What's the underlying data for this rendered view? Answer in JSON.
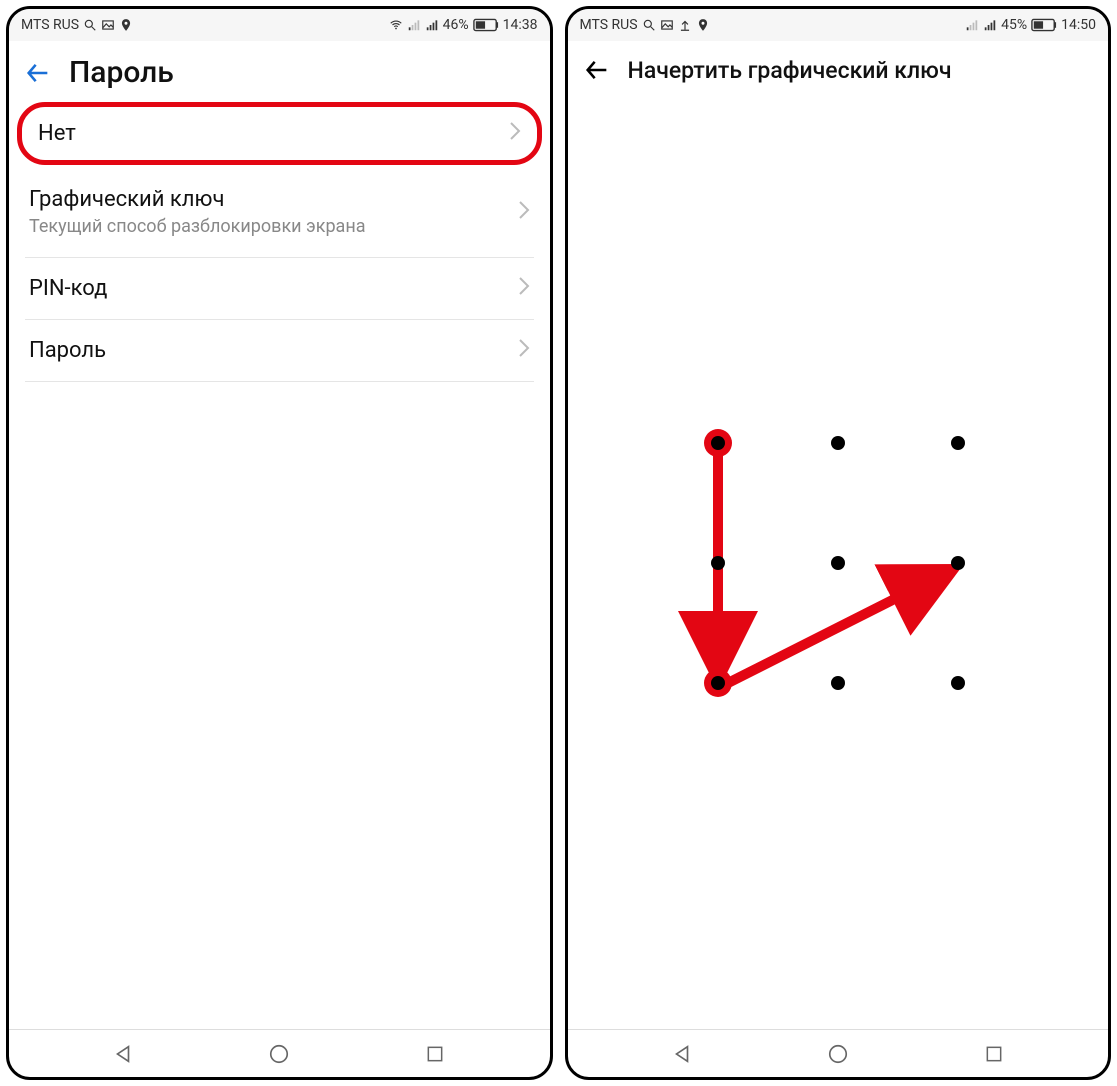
{
  "left": {
    "status": {
      "carrier": "MTS RUS",
      "battery": "46%",
      "time": "14:38",
      "icons": [
        "search",
        "image",
        "location",
        "wifi",
        "signal-weak",
        "signal-strong",
        "battery"
      ]
    },
    "title": "Пароль",
    "options": [
      {
        "label": "Нет",
        "sub": "",
        "highlighted": true
      },
      {
        "label": "Графический ключ",
        "sub": "Текущий способ разблокировки экрана",
        "highlighted": false
      },
      {
        "label": "PIN-код",
        "sub": "",
        "highlighted": false
      },
      {
        "label": "Пароль",
        "sub": "",
        "highlighted": false
      }
    ]
  },
  "right": {
    "status": {
      "carrier": "MTS RUS",
      "battery": "45%",
      "time": "14:50",
      "icons": [
        "search",
        "image",
        "upload",
        "location",
        "signal-weak",
        "signal-strong",
        "battery"
      ]
    },
    "title": "Начертить графический ключ",
    "pattern": {
      "dots": [
        [
          0,
          0
        ],
        [
          1,
          0
        ],
        [
          2,
          0
        ],
        [
          0,
          1
        ],
        [
          1,
          1
        ],
        [
          2,
          1
        ],
        [
          0,
          2
        ],
        [
          1,
          2
        ],
        [
          2,
          2
        ]
      ],
      "path_nodes": [
        [
          0,
          0
        ],
        [
          0,
          2
        ],
        [
          2,
          1
        ]
      ],
      "highlight_color": "#e30613"
    }
  },
  "nav_icons": [
    "back-triangle",
    "home-circle",
    "recent-square"
  ]
}
